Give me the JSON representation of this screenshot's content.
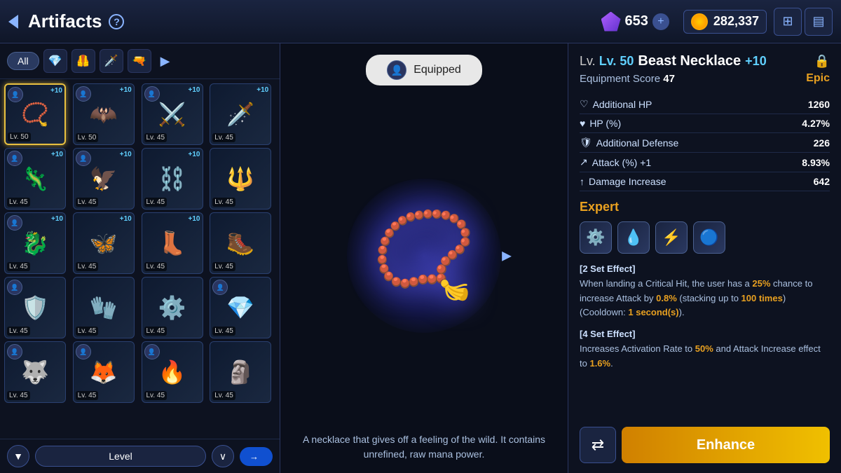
{
  "header": {
    "title": "Artifacts",
    "help_label": "?",
    "gem_count": "653",
    "gold_count": "282,337",
    "add_label": "+"
  },
  "filter": {
    "all_label": "All",
    "more_label": "▶"
  },
  "artifacts": [
    {
      "id": 1,
      "level": "Lv. 50",
      "plus": "+10",
      "has_avatar": true,
      "selected": true,
      "type": "necklace",
      "icon": "📿"
    },
    {
      "id": 2,
      "level": "Lv. 50",
      "plus": "+10",
      "has_avatar": true,
      "selected": false,
      "type": "necklace",
      "icon": "🦇"
    },
    {
      "id": 3,
      "level": "Lv. 45",
      "plus": "+10",
      "has_avatar": true,
      "selected": false,
      "type": "weapon",
      "icon": "⚔️"
    },
    {
      "id": 4,
      "level": "Lv. 45",
      "plus": "+10",
      "has_avatar": false,
      "selected": false,
      "type": "weapon",
      "icon": "🗡️"
    },
    {
      "id": 5,
      "level": "Lv. 45",
      "plus": "+10",
      "has_avatar": true,
      "selected": false,
      "type": "necklace",
      "icon": "🦎"
    },
    {
      "id": 6,
      "level": "Lv. 45",
      "plus": "+10",
      "has_avatar": true,
      "selected": false,
      "type": "necklace",
      "icon": "🦅"
    },
    {
      "id": 7,
      "level": "Lv. 45",
      "plus": "+10",
      "has_avatar": false,
      "selected": false,
      "type": "weapon",
      "icon": "⛓️"
    },
    {
      "id": 8,
      "level": "Lv. 45",
      "plus": "",
      "has_avatar": false,
      "selected": false,
      "type": "weapon",
      "icon": "🔱"
    },
    {
      "id": 9,
      "level": "Lv. 45",
      "plus": "+10",
      "has_avatar": true,
      "selected": false,
      "type": "weapon",
      "icon": "🐉"
    },
    {
      "id": 10,
      "level": "Lv. 45",
      "plus": "+10",
      "has_avatar": false,
      "selected": false,
      "type": "necklace",
      "icon": "🦋"
    },
    {
      "id": 11,
      "level": "Lv. 45",
      "plus": "+10",
      "has_avatar": false,
      "selected": false,
      "type": "boots",
      "icon": "👢"
    },
    {
      "id": 12,
      "level": "Lv. 45",
      "plus": "",
      "has_avatar": false,
      "selected": false,
      "type": "boots",
      "icon": "🥾"
    },
    {
      "id": 13,
      "level": "Lv. 45",
      "plus": "",
      "has_avatar": true,
      "selected": false,
      "type": "armor",
      "icon": "🛡️"
    },
    {
      "id": 14,
      "level": "Lv. 45",
      "plus": "",
      "has_avatar": false,
      "selected": false,
      "type": "gloves",
      "icon": "🧤"
    },
    {
      "id": 15,
      "level": "Lv. 45",
      "plus": "",
      "has_avatar": false,
      "selected": false,
      "type": "armor",
      "icon": "⚙️"
    },
    {
      "id": 16,
      "level": "Lv. 45",
      "plus": "",
      "has_avatar": true,
      "selected": false,
      "type": "necklace",
      "icon": "💎"
    },
    {
      "id": 17,
      "level": "Lv. 45",
      "plus": "",
      "has_avatar": true,
      "selected": false,
      "type": "weapon",
      "icon": "🐺"
    },
    {
      "id": 18,
      "level": "Lv. 45",
      "plus": "",
      "has_avatar": true,
      "selected": false,
      "type": "armor",
      "icon": "🦊"
    },
    {
      "id": 19,
      "level": "Lv. 45",
      "plus": "",
      "has_avatar": true,
      "selected": false,
      "type": "gloves",
      "icon": "🔥"
    },
    {
      "id": 20,
      "level": "Lv. 45",
      "plus": "",
      "has_avatar": false,
      "selected": false,
      "type": "weapon",
      "icon": "🗿"
    }
  ],
  "sort": {
    "label": "Level",
    "filter_icon": "▼"
  },
  "equipped": {
    "label": "Equipped"
  },
  "detail": {
    "level": "Lv. 50",
    "name": "Beast Necklace",
    "enhance": "+10",
    "score_label": "Equipment Score",
    "score_value": "47",
    "rarity": "Epic",
    "stats": [
      {
        "icon": "♡",
        "label": "Additional HP",
        "value": "1260"
      },
      {
        "icon": "♥",
        "label": "HP (%)",
        "value": "4.27%"
      },
      {
        "icon": "🛡",
        "label": "Additional Defense",
        "value": "226"
      },
      {
        "icon": "↗",
        "label": "Attack (%) +1",
        "value": "8.93%"
      },
      {
        "icon": "↑",
        "label": "Damage Increase",
        "value": "642"
      }
    ],
    "set_name": "Expert",
    "set_icons": [
      "⚙️",
      "💧",
      "⚡",
      "🔵"
    ],
    "set_2_effect": "[2 Set Effect]\nWhen landing a Critical Hit, the user has a 25% chance to increase Attack by 0.8% (stacking up to 100 times) (Cooldown: 1 second(s)).",
    "set_2_highlights": [
      "25%",
      "0.8%",
      "100 times",
      "1 second(s)"
    ],
    "set_4_effect": "[4 Set Effect]\nIncreases Activation Rate to 50% and Attack Increase effect to 1.6%.",
    "set_4_highlights": [
      "50%",
      "1.6%"
    ]
  },
  "actions": {
    "transfer_icon": "→👤",
    "enhance_label": "Enhance"
  },
  "description": "A necklace that gives off a feeling of the wild. It contains unrefined, raw mana power."
}
